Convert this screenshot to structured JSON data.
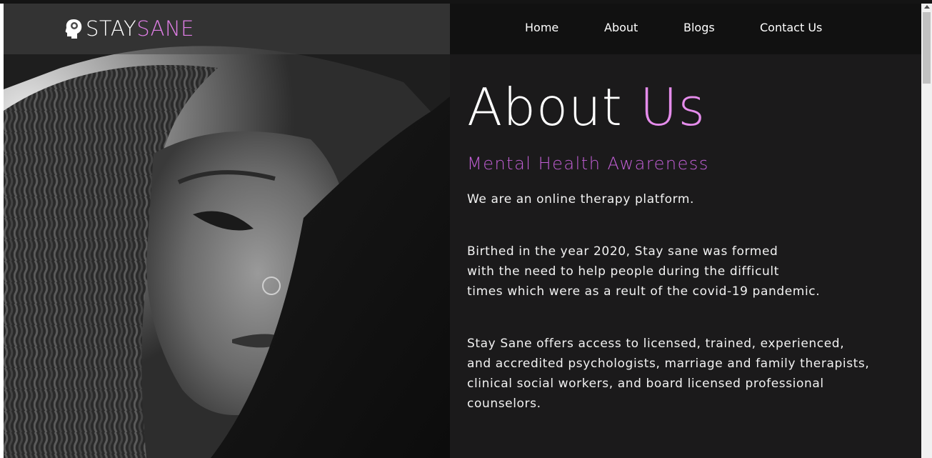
{
  "brand": {
    "name_part1": "STAY",
    "name_part2": "SANE",
    "icon": "head-brain-icon",
    "accent_color": "#e07ee6"
  },
  "nav": {
    "items": [
      {
        "label": "Home"
      },
      {
        "label": "About"
      },
      {
        "label": "Blogs"
      },
      {
        "label": "Contact Us"
      }
    ]
  },
  "hero_image": {
    "icon": "portrait-photo"
  },
  "about": {
    "title_part1": "About",
    "title_part2": "Us",
    "subtitle": "Mental Health Awareness",
    "paragraph1": [
      "We are an online therapy platform."
    ],
    "paragraph2": [
      "Birthed in the year 2020, Stay sane was formed",
      "with the need to help people during the difficult",
      "times which were as a reult of the covid-19 pandemic."
    ],
    "paragraph3": [
      "Stay Sane offers access to licensed, trained, experienced,",
      "and accredited psychologists, marriage and family therapists,",
      "clinical social workers, and board licensed professional",
      "counselors."
    ]
  },
  "colors": {
    "background": "#1b1a1b",
    "header": "#111111",
    "title_accent": "#e58ceb",
    "subtitle": "#c25fd6"
  }
}
